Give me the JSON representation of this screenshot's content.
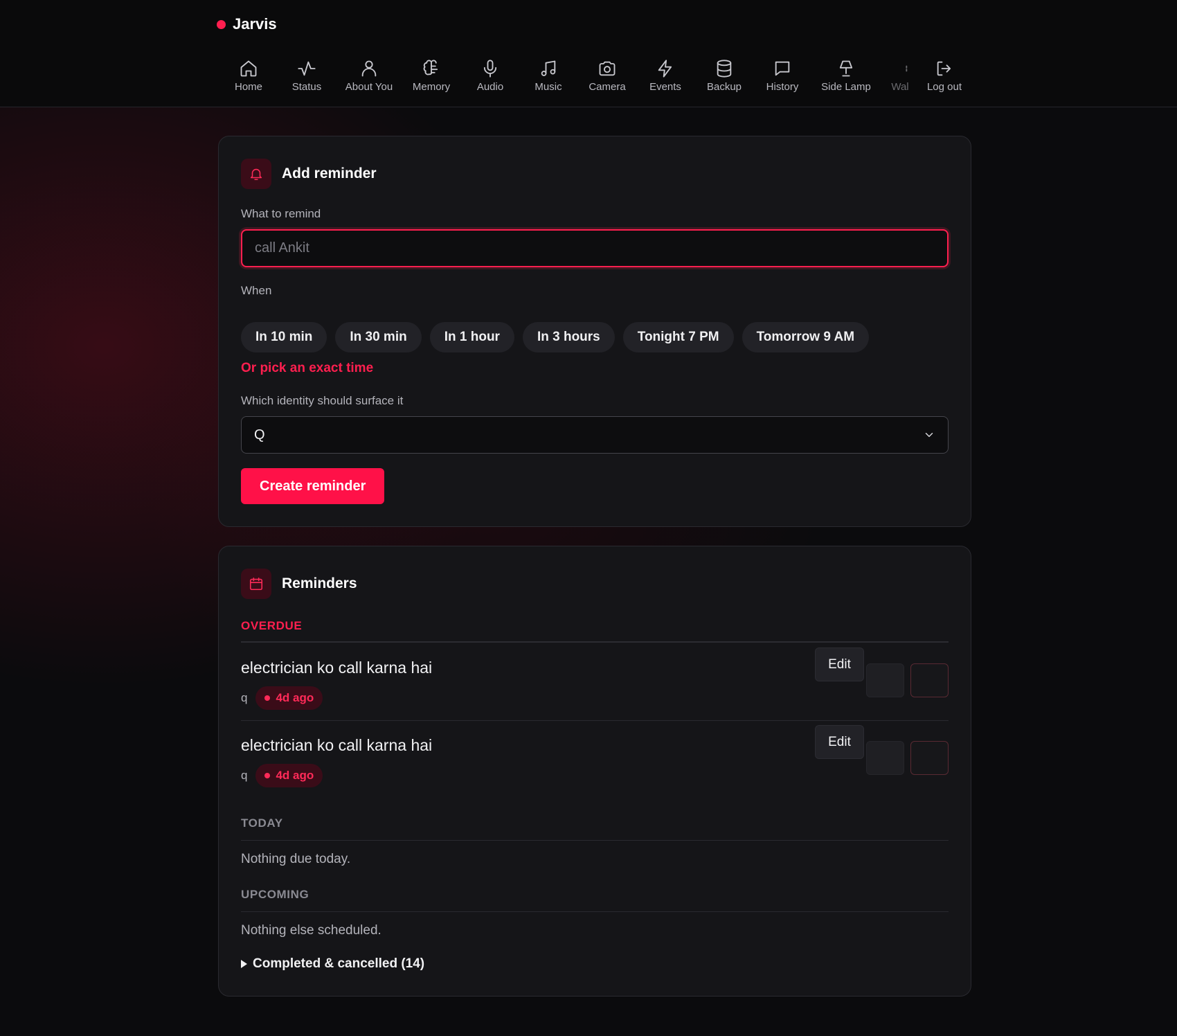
{
  "app": {
    "name": "Jarvis",
    "accent": "#ff1f4f"
  },
  "nav": [
    {
      "label": "Home",
      "icon": "home-icon"
    },
    {
      "label": "Status",
      "icon": "activity-icon"
    },
    {
      "label": "About You",
      "icon": "user-icon"
    },
    {
      "label": "Memory",
      "icon": "brain-icon"
    },
    {
      "label": "Audio",
      "icon": "microphone-icon"
    },
    {
      "label": "Music",
      "icon": "music-note-icon"
    },
    {
      "label": "Camera",
      "icon": "camera-icon"
    },
    {
      "label": "Events",
      "icon": "lightning-icon"
    },
    {
      "label": "Backup",
      "icon": "database-icon"
    },
    {
      "label": "History",
      "icon": "chat-bubble-icon"
    },
    {
      "label": "Side Lamp",
      "icon": "lamp-icon"
    },
    {
      "label": "Wal",
      "icon": "wall-icon"
    },
    {
      "label": "Log out",
      "icon": "logout-icon"
    }
  ],
  "add_reminder": {
    "title": "Add reminder",
    "what_label": "What to remind",
    "what_placeholder": "call Ankit",
    "what_value": "",
    "when_label": "When",
    "quick_times": [
      "In 10 min",
      "In 30 min",
      "In 1 hour",
      "In 3 hours",
      "Tonight 7 PM",
      "Tomorrow 9 AM"
    ],
    "exact_time_link": "Or pick an exact time",
    "identity_label": "Which identity should surface it",
    "identity_selected": "Q",
    "submit_label": "Create reminder"
  },
  "reminders": {
    "title": "Reminders",
    "overdue_title": "OVERDUE",
    "overdue": [
      {
        "text": "electrician ko call karna hai",
        "who": "q",
        "when": "4d ago",
        "edit_label": "Edit"
      },
      {
        "text": "electrician ko call karna hai",
        "who": "q",
        "when": "4d ago",
        "edit_label": "Edit"
      }
    ],
    "today_title": "TODAY",
    "today_empty": "Nothing due today.",
    "upcoming_title": "UPCOMING",
    "upcoming_empty": "Nothing else scheduled.",
    "completed_summary": "Completed & cancelled (14)"
  }
}
